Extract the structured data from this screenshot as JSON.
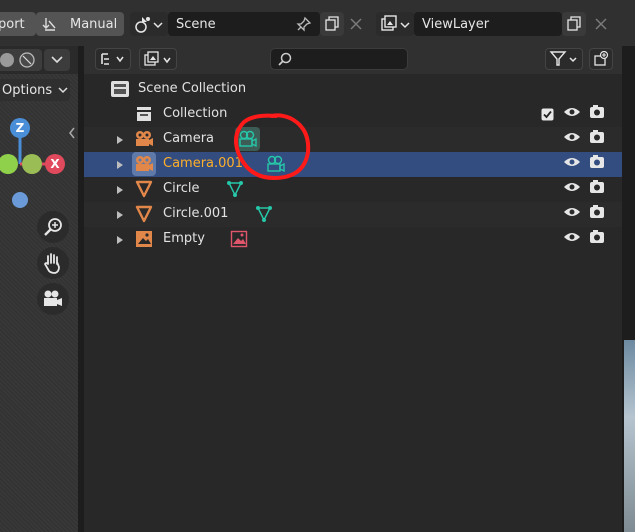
{
  "topbar": {
    "export_partial": "port",
    "transform_mode": "Manual",
    "scene_name": "Scene",
    "view_layer": "ViewLayer"
  },
  "viewport": {
    "options_label": "Options",
    "gizmo_z": "Z",
    "gizmo_x": "X"
  },
  "outliner": {
    "search_placeholder": "",
    "scene_collection": "Scene Collection",
    "rows": [
      {
        "name": "Collection",
        "type": "collection"
      },
      {
        "name": "Camera",
        "type": "camera"
      },
      {
        "name": "Camera.001",
        "type": "camera",
        "selected": true
      },
      {
        "name": "Circle",
        "type": "mesh"
      },
      {
        "name": "Circle.001",
        "type": "mesh"
      },
      {
        "name": "Empty",
        "type": "image"
      }
    ]
  },
  "colors": {
    "selection": "#334d80",
    "active_text": "#ffaf29",
    "object_icon": "#e1874a",
    "data_icon": "#26c6a8",
    "annotation": "#ff1a1a"
  }
}
